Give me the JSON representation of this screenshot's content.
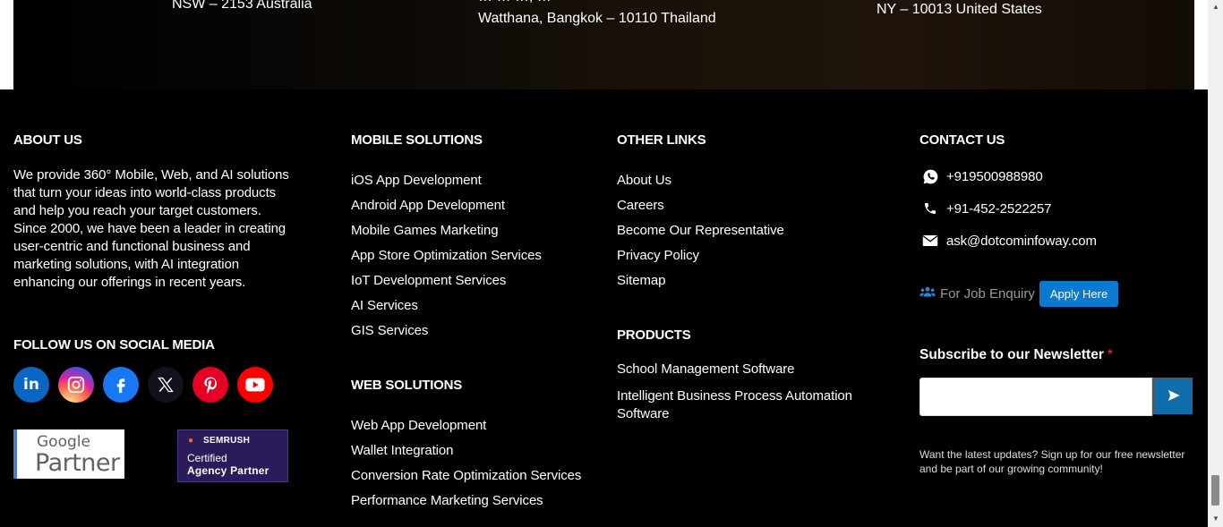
{
  "top_band": {
    "address_au": "NSW – 2153 Australia",
    "address_th_cut": "… … …, …",
    "address_th": "Watthana, Bangkok – 10110 Thailand",
    "address_us": "NY – 10013 United States"
  },
  "about": {
    "heading": "ABOUT US",
    "text": "We provide 360° Mobile, Web, and AI solutions that turn your ideas into world-class products and help you reach your target customers. Since 2000, we have been a leader in creating user-centric and functional business and marketing solutions, with AI integration enhancing our offerings in recent years.",
    "social_heading": "FOLLOW US ON SOCIAL MEDIA",
    "social_icons": [
      "linkedin-icon",
      "instagram-icon",
      "facebook-icon",
      "x-icon",
      "pinterest-icon",
      "youtube-icon"
    ],
    "badges": {
      "google_top": "Google",
      "google_bottom": "Partner",
      "semrush_brand": "SEMRUSH",
      "semrush_line1": "Certified",
      "semrush_line2": "Agency Partner"
    }
  },
  "mobile_solutions": {
    "heading": "MOBILE SOLUTIONS",
    "items": [
      "iOS App Development",
      "Android App Development",
      "Mobile Games Marketing",
      "App Store Optimization Services",
      "IoT Development Services",
      "AI Services",
      "GIS Services"
    ]
  },
  "web_solutions": {
    "heading": "WEB SOLUTIONS",
    "items": [
      "Web App Development",
      "Wallet Integration",
      "Conversion Rate Optimization Services",
      "Performance Marketing Services"
    ]
  },
  "other_links": {
    "heading": "OTHER LINKS",
    "items": [
      "About Us",
      "Careers",
      "Become Our Representative",
      "Privacy Policy",
      "Sitemap"
    ]
  },
  "products": {
    "heading": "PRODUCTS",
    "items": [
      "School Management Software",
      "Intelligent Business Process Automation",
      "Software"
    ]
  },
  "contact": {
    "heading": "CONTACT US",
    "whatsapp": "+919500988980",
    "phone": "+91-452-2522257",
    "email": "ask@dotcominfoway.com",
    "job_label": "For Job Enquiry",
    "apply_label": "Apply Here",
    "subscribe_title": "Subscribe to our Newsletter",
    "required_mark": "*",
    "newsletter_placeholder": "",
    "newsletter_note": "Want the latest updates? Sign up for our free newsletter and be part of our growing community!"
  },
  "colors": {
    "footer_bg": "#000000",
    "apply_button": "#0a7ad0",
    "submit_button": "#0f6eaa",
    "required": "#e23b3b"
  }
}
